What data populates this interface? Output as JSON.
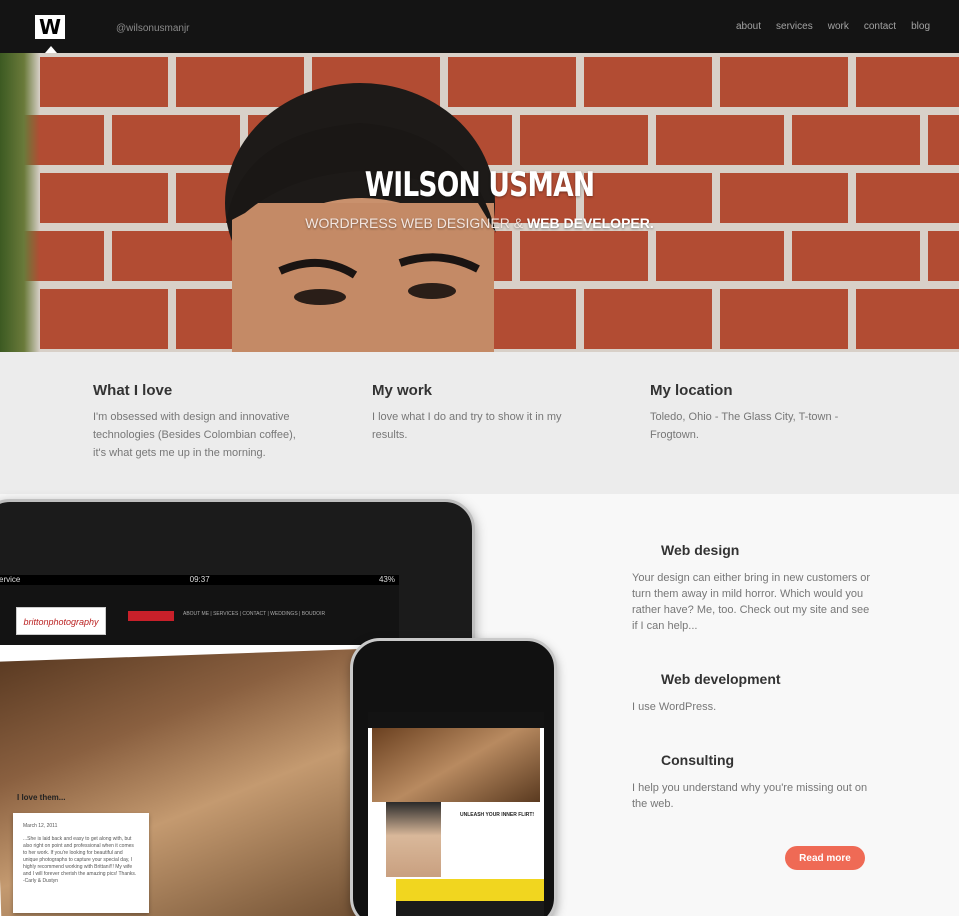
{
  "header": {
    "logo": "W",
    "handle": "@wilsonusmanjr",
    "nav": [
      "about",
      "services",
      "work",
      "contact",
      "blog"
    ]
  },
  "hero": {
    "title": "WILSON USMAN",
    "subtitle_light": "WORDPRESS WEB DESIGNER &",
    "subtitle_bold": "WEB DEVELOPER."
  },
  "features": [
    {
      "title": "What I love",
      "text": "I'm obsessed with design and innovative technologies (Besides Colombian coffee), it's what gets me up in the morning."
    },
    {
      "title": "My work",
      "text": "I love what I do and try to show it in my results."
    },
    {
      "title": "My location",
      "text": "Toledo, Ohio - The Glass City, T-town - Frogtown."
    }
  ],
  "devices": {
    "status_left": "o Service",
    "status_time": "09:37",
    "status_battery": "43%",
    "tablet_logo": "brittonphotography",
    "tablet_menu": "ABOUT ME | SERVICES | CONTACT | WEDDINGS | BOUDOIR",
    "tablet_card_title": "I love them...",
    "tablet_card_date": "March 12, 2011",
    "tablet_card_text": "...She is laid back and easy to get along with, but also right on point and professional when it comes to her work. If you're looking for beautiful and unique photographs to capture your special day, I highly recommend working with Brittani!!! My wife and I will forever cherish the amazing pics! Thanks. -Carly & Dustyn",
    "phone_text": "UNLEASH YOUR INNER FLIRT!"
  },
  "services": [
    {
      "title": "Web design",
      "text": "Your design can either bring in new customers or turn them away in mild horror. Which would you rather have? Me, too. Check out my site and see if I can help..."
    },
    {
      "title": "Web development",
      "text": "I use WordPress."
    },
    {
      "title": "Consulting",
      "text": "I help you understand why you're missing out on the web."
    }
  ],
  "read_more": "Read more",
  "colors": {
    "accent": "#ef6a55",
    "topbar": "#141414"
  }
}
